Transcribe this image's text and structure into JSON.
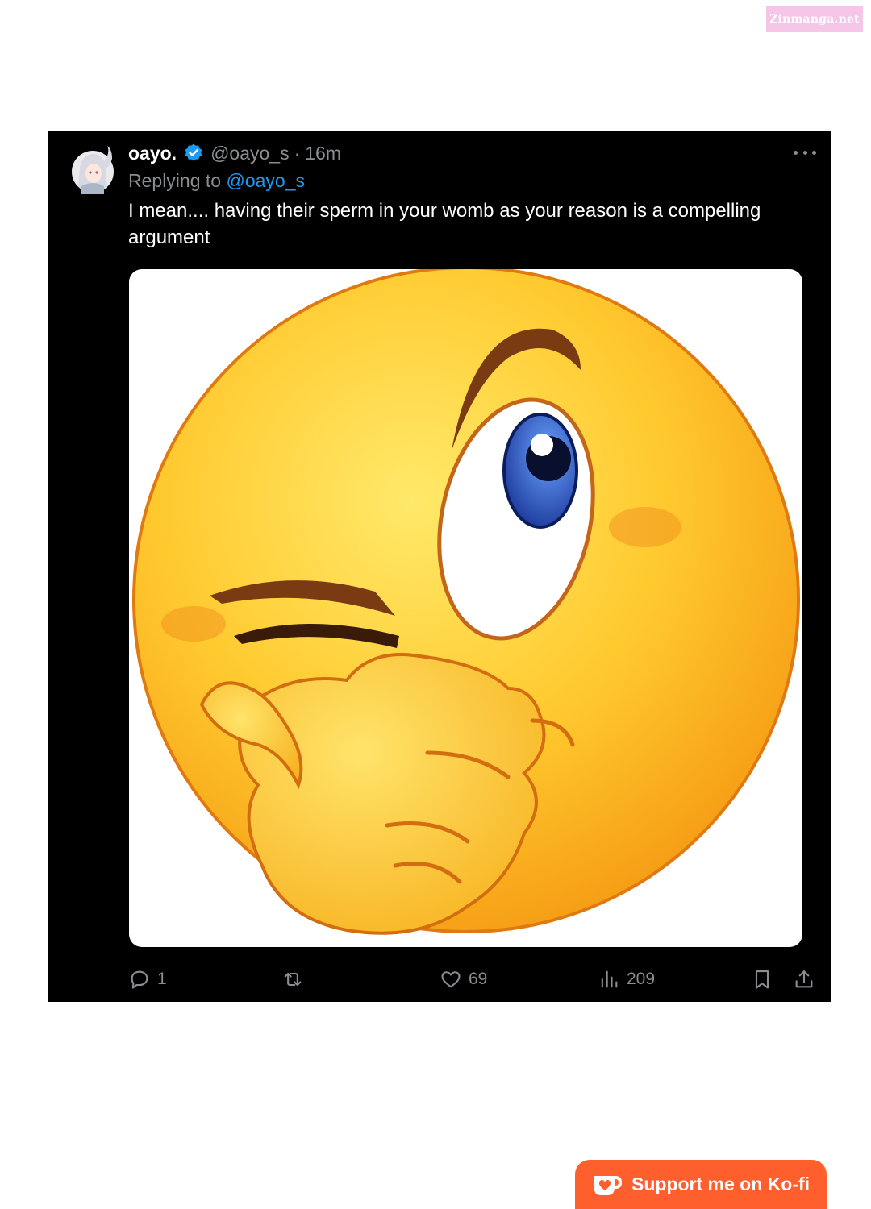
{
  "watermark": "Zinmanga.net",
  "tweet": {
    "display_name": "oayo.",
    "handle": "@oayo_s",
    "separator": "·",
    "time": "16m",
    "replying_prefix": "Replying to ",
    "replying_mention": "@oayo_s",
    "text": "I mean.... having their sperm in your womb as your reason is a compelling argument",
    "media_icon": "winking-thinking-emoji-icon",
    "stats": {
      "replies": "1",
      "reposts": "",
      "likes": "69",
      "views": "209"
    }
  },
  "kofi": {
    "label": "Support me on Ko-fi",
    "icon": "kofi-cup-icon"
  },
  "colors": {
    "background": "#000000",
    "text": "#ffffff",
    "muted": "#8a8d91",
    "link": "#1d9bf0",
    "verified": "#1d9bf0",
    "kofi": "#ff5e2d",
    "watermark_bg": "#f5c6e8"
  }
}
